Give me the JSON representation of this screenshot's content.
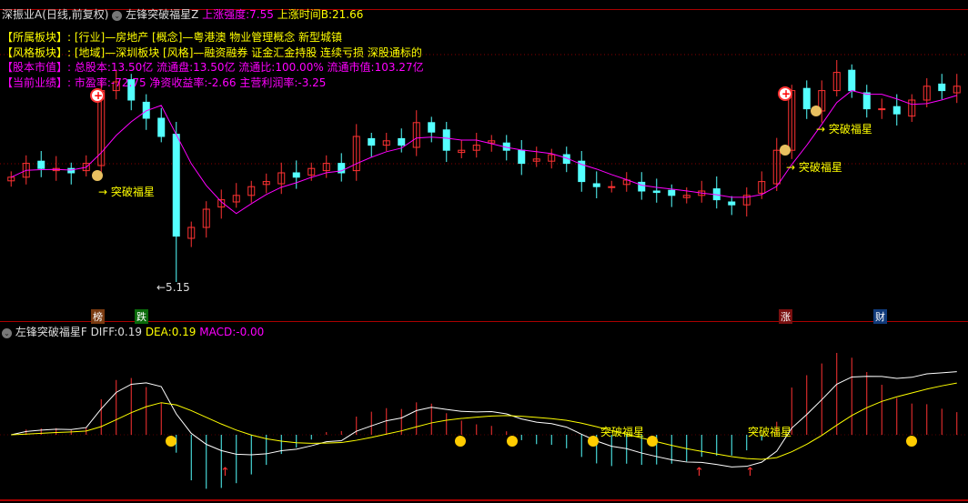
{
  "header": {
    "stock": "深振业A",
    "period": "(日线,前复权)",
    "indicator": "左锋突破福星Z",
    "strength_label": "上涨强度:",
    "strength": "7.55",
    "time_label": "上涨时间B:",
    "time": "21.66"
  },
  "info": [
    {
      "label": "【所属板块】:",
      "text": "[行业]—房地产 [概念]—粤港澳 物业管理概念 新型城镇",
      "color": "#ffff00"
    },
    {
      "label": "【风格板块】:",
      "text": "[地域]—深圳板块 [风格]—融资融券 证金汇金持股 连续亏损 深股通标的",
      "color": "#ffff00"
    },
    {
      "label": "【股本市值】:",
      "text": "总股本:13.50亿 流通盘:13.50亿 流通比:100.00% 流通市值:103.27亿",
      "color": "#ff00ff"
    },
    {
      "label": "【当前业绩】:",
      "text": "市盈率:-72.75 净资收益率:-2.66 主营利润率:-3.25",
      "color": "#ff00ff"
    }
  ],
  "annotations": {
    "signal": "→ 突破福星",
    "low": "←5.15",
    "tags": [
      "榜",
      "跌",
      "涨",
      "财"
    ]
  },
  "lower": {
    "indicator": "左锋突破福星F",
    "diff_label": "DIFF:",
    "diff": "0.19",
    "dea_label": "DEA:",
    "dea": "0.19",
    "macd_label": "MACD:",
    "macd": "-0.00",
    "signal": "突破福星"
  },
  "colors": {
    "up": "#ff3232",
    "down": "#54ffff",
    "ma": "#ff00ff",
    "diff": "#ffffff",
    "dea": "#ffff00"
  },
  "chart_data": {
    "type": "candlestick",
    "closes": [
      6.59,
      6.78,
      6.71,
      6.71,
      6.65,
      6.78,
      7.78,
      7.9,
      7.65,
      7.4,
      7.15,
      5.78,
      5.9,
      6.15,
      6.28,
      6.34,
      6.46,
      6.53,
      6.65,
      6.59,
      6.71,
      6.78,
      6.65,
      7.15,
      7.03,
      7.09,
      7.03,
      7.34,
      7.21,
      6.96,
      6.96,
      7.03,
      7.09,
      6.96,
      6.78,
      6.84,
      6.9,
      6.78,
      6.53,
      6.46,
      6.46,
      6.55,
      6.4,
      6.38,
      6.34,
      6.34,
      6.4,
      6.28,
      6.21,
      6.34,
      6.53,
      6.96,
      7.78,
      7.53,
      7.78,
      8.03,
      7.78,
      7.53,
      7.53,
      7.46,
      7.65,
      7.84,
      7.78,
      7.84
    ],
    "low_mark": 5.15
  }
}
